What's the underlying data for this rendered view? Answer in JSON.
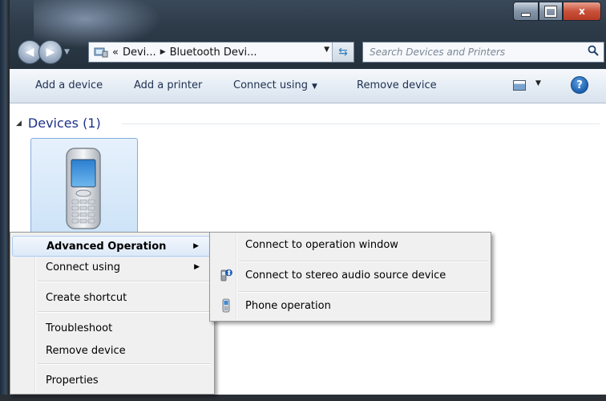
{
  "window": {
    "title_buttons": {
      "minimize_icon": "minimize-icon",
      "maximize_icon": "maximize-icon",
      "close_glyph": "x"
    }
  },
  "navigation": {
    "back_icon": "back-arrow-icon",
    "forward_icon": "forward-arrow-icon",
    "address": {
      "overflow": "«",
      "crumb_1": "Devi...",
      "crumb_2": "Bluetooth Devi..."
    },
    "search_placeholder": "Search Devices and Printers"
  },
  "commandbar": {
    "add_device": "Add a device",
    "add_printer": "Add a printer",
    "connect_using": "Connect using",
    "remove_device": "Remove device"
  },
  "group": {
    "title": "Devices (1)"
  },
  "context_menu": {
    "items": [
      {
        "label": "Advanced Operation",
        "has_submenu": true,
        "highlighted": true
      },
      {
        "label": "Connect using",
        "has_submenu": true
      },
      {
        "label": "Create shortcut"
      },
      {
        "label": "Troubleshoot"
      },
      {
        "label": "Remove device"
      },
      {
        "label": "Properties"
      }
    ]
  },
  "submenu": {
    "items": [
      {
        "label": "Connect to operation window"
      },
      {
        "label": "Connect to stereo audio source device",
        "icon": "bluetooth-audio-icon"
      },
      {
        "label": "Phone operation",
        "icon": "phone-icon"
      }
    ]
  }
}
